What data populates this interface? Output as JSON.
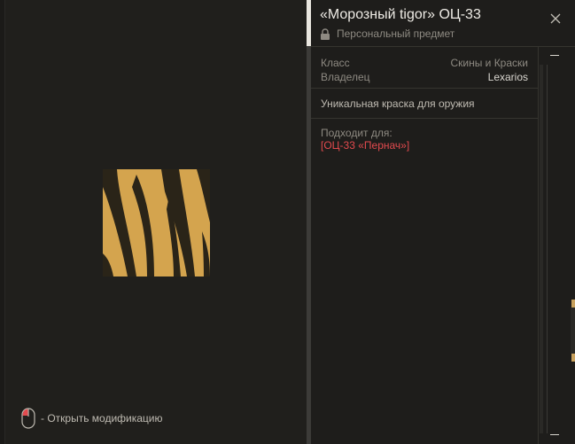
{
  "item": {
    "title": "«Морозный tigor» ОЦ-33",
    "subtitle": "Персональный предмет",
    "class_label": "Класс",
    "class_value": "Скины и Краски",
    "owner_label": "Владелец",
    "owner_value": "Lexarios",
    "description": "Уникальная краска для оружия",
    "fits_label": "Подходит для:",
    "fits_value": "[ОЦ-33 «Пернач»]"
  },
  "preview": {
    "hint": "- Открыть модификацию",
    "swatch_colors": [
      "#d4a44e",
      "#2a2418"
    ]
  },
  "icons": {
    "close": "close-icon",
    "lock": "lock-icon",
    "mouse": "mouse-icon"
  },
  "colors": {
    "accent_link": "#e24a4e",
    "background": "#1b1a18"
  }
}
